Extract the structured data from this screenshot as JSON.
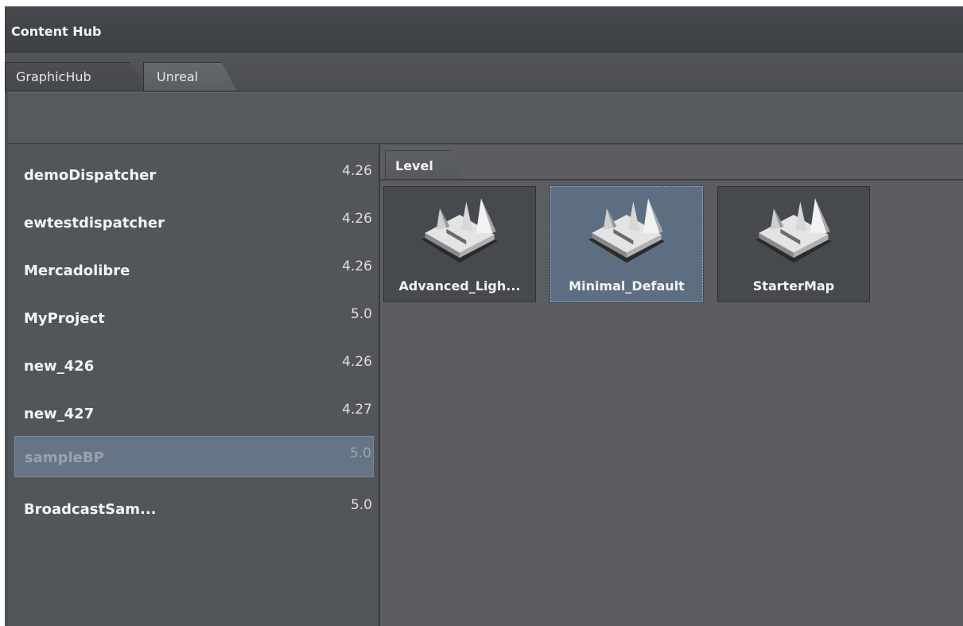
{
  "window": {
    "title": "Content Hub"
  },
  "tabs": [
    {
      "label": "GraphicHub"
    },
    {
      "label": "Unreal"
    }
  ],
  "projects": [
    {
      "name": "demoDispatcher",
      "version": "4.26"
    },
    {
      "name": "ewtestdispatcher",
      "version": "4.26"
    },
    {
      "name": "Mercadolibre",
      "version": "4.26"
    },
    {
      "name": "MyProject",
      "version": "5.0"
    },
    {
      "name": "new_426",
      "version": "4.26"
    },
    {
      "name": "new_427",
      "version": "4.27"
    },
    {
      "name": "sampleBP",
      "version": "5.0"
    },
    {
      "name": "BroadcastSam...",
      "version": "5.0"
    }
  ],
  "selected_project": "sampleBP",
  "content": {
    "category_tab": "Level",
    "items": [
      {
        "label": "Advanced_Ligh...",
        "icon": "level-map-icon"
      },
      {
        "label": "Minimal_Default",
        "icon": "level-map-icon"
      },
      {
        "label": "StarterMap",
        "icon": "level-map-icon"
      }
    ],
    "selected_item": "Minimal_Default"
  }
}
